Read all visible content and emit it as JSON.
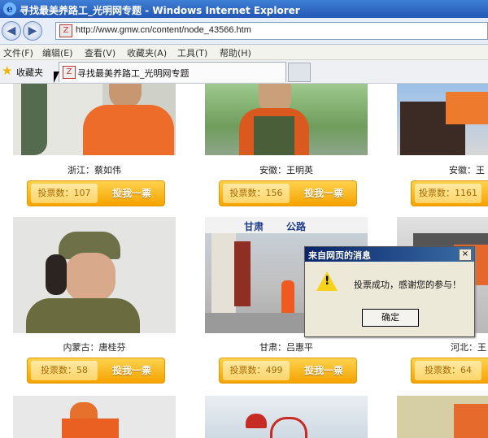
{
  "window": {
    "title": "寻找最美养路工_光明网专题 - Windows Internet Explorer"
  },
  "address": {
    "url": "http://www.gmw.cn/content/node_43566.htm"
  },
  "menu": [
    "文件(F)",
    "编辑(E)",
    "查看(V)",
    "收藏夹(A)",
    "工具(T)",
    "帮助(H)"
  ],
  "favorites": {
    "label": "收藏夹"
  },
  "tab": {
    "title": "寻找最美养路工_光明网专题"
  },
  "vote_button_label": "投我一票",
  "cards": [
    {
      "caption": "浙江：蔡如伟",
      "count": "投票数：107"
    },
    {
      "caption": "安徽：王明英",
      "count": "投票数：156"
    },
    {
      "caption": "安徽：王",
      "count": "投票数：1161"
    },
    {
      "caption": "内蒙古：唐桂芬",
      "count": "投票数：58"
    },
    {
      "caption": "甘肃：吕惠平",
      "count": "投票数：499"
    },
    {
      "caption": "河北：王",
      "count": "投票数：64"
    }
  ],
  "photo_sign": {
    "left": "甘肃",
    "right": "公路"
  },
  "dialog": {
    "title": "来自网页的消息",
    "message": "投票成功，感谢您的参与！",
    "ok": "确定",
    "close": "×"
  },
  "colors": {
    "title_bar": "#2357b5",
    "vote_orange": "#f5a300",
    "dialog_bg": "#ece9d8"
  }
}
